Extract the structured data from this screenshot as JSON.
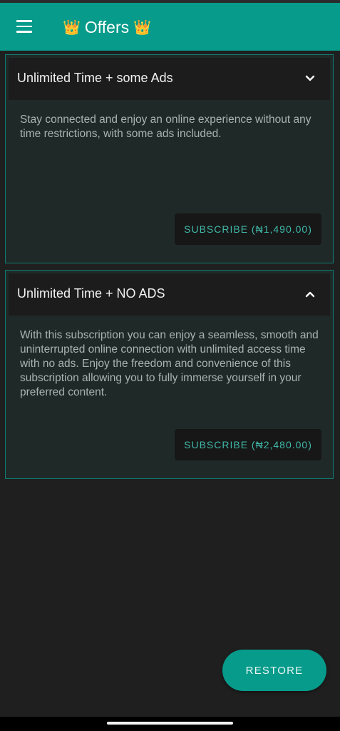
{
  "app_bar": {
    "title": "Offers",
    "crown_left": "👑",
    "crown_right": "👑",
    "menu_icon": "hamburger-menu-icon",
    "background_color": "#069b8a"
  },
  "offers": [
    {
      "title": "Unlimited Time + some Ads",
      "description": "Stay connected and enjoy an online experience without any time restrictions, with some ads included.",
      "subscribe_label": "SUBSCRIBE (₦1,490.00)",
      "chevron": "chevron-down-icon"
    },
    {
      "title": "Unlimited Time + NO ADS",
      "description": "With this subscription you can enjoy a seamless, smooth and uninterrupted online connection with unlimited access time with no ads. Enjoy the freedom and convenience of this subscription allowing you to fully immerse yourself in your preferred content.",
      "subscribe_label": "SUBSCRIBE (₦2,480.00)",
      "chevron": "chevron-up-icon"
    }
  ],
  "restore_button": {
    "label": "RESTORE"
  },
  "colors": {
    "accent": "#069b8a",
    "card_border": "#0d7c72",
    "subscribe_text": "#3fb8a8",
    "background": "#1f1f1f"
  }
}
